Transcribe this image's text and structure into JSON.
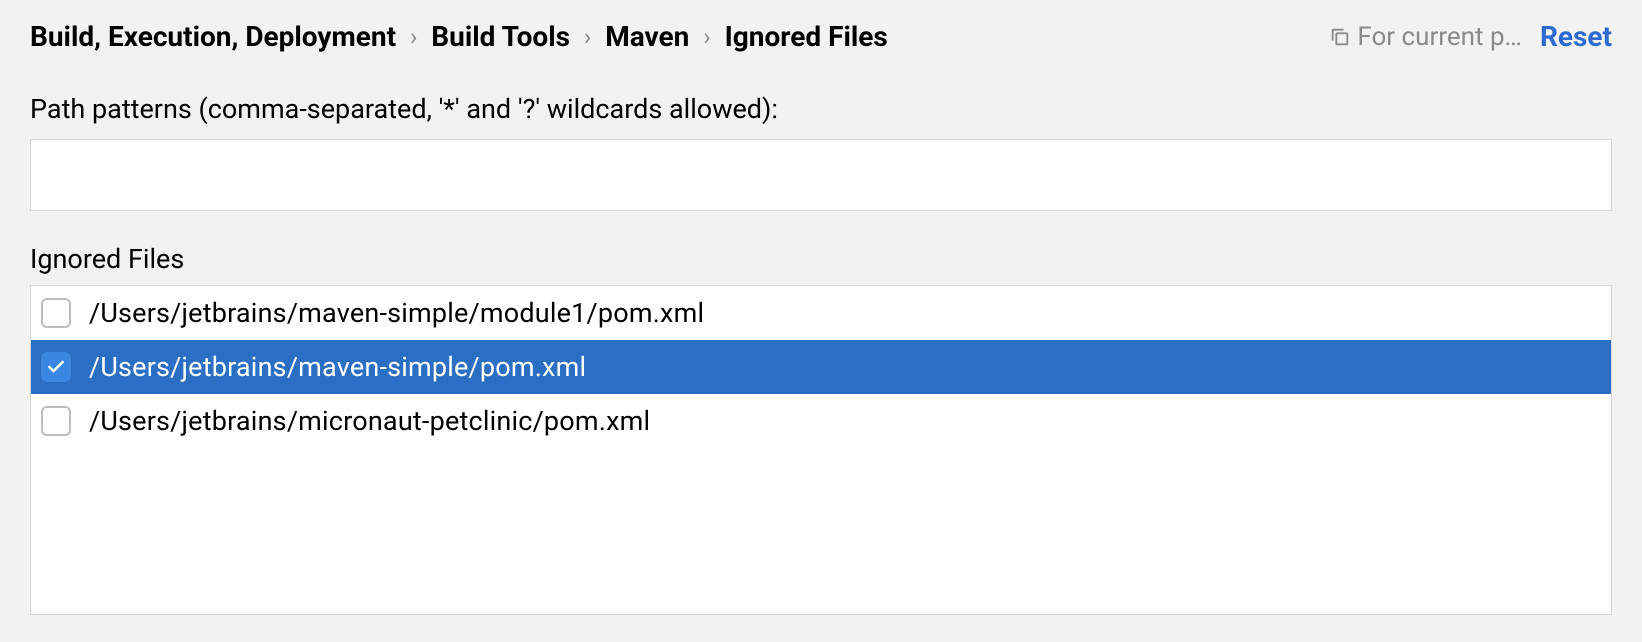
{
  "header": {
    "breadcrumb": [
      "Build, Execution, Deployment",
      "Build Tools",
      "Maven",
      "Ignored Files"
    ],
    "scope_label": "For current p…",
    "reset_label": "Reset"
  },
  "patterns": {
    "label": "Path patterns (comma-separated, '*' and '?' wildcards allowed):",
    "value": ""
  },
  "ignored": {
    "section_label": "Ignored Files",
    "items": [
      {
        "path": "/Users/jetbrains/maven-simple/module1/pom.xml",
        "checked": false,
        "selected": false
      },
      {
        "path": "/Users/jetbrains/maven-simple/pom.xml",
        "checked": true,
        "selected": true
      },
      {
        "path": "/Users/jetbrains/micronaut-petclinic/pom.xml",
        "checked": false,
        "selected": false
      }
    ]
  }
}
